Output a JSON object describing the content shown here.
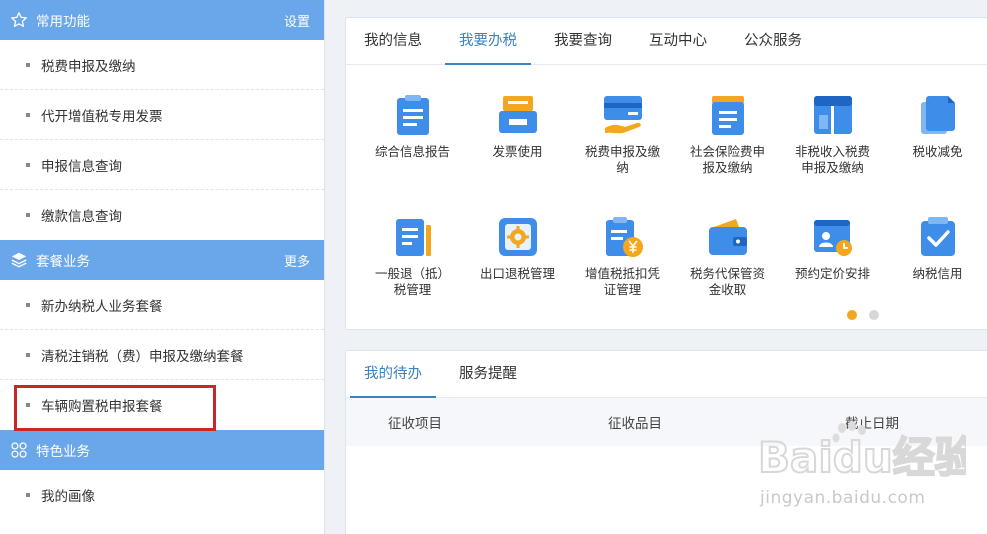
{
  "sidebar": {
    "common": {
      "title": "常用功能",
      "action": "设置",
      "items": [
        "税费申报及缴纳",
        "代开增值税专用发票",
        "申报信息查询",
        "缴款信息查询"
      ]
    },
    "package": {
      "title": "套餐业务",
      "action": "更多",
      "items": [
        "新办纳税人业务套餐",
        "清税注销税（费）申报及缴纳套餐",
        "车辆购置税申报套餐"
      ]
    },
    "special": {
      "title": "特色业务",
      "items": [
        "我的画像"
      ]
    }
  },
  "main": {
    "tabs": [
      "我的信息",
      "我要办税",
      "我要查询",
      "互动中心",
      "公众服务"
    ],
    "active_tab": "我要办税",
    "tiles": [
      {
        "label": "综合信息报告",
        "icon": "clipboard-report-icon"
      },
      {
        "label": "发票使用",
        "icon": "invoice-printer-icon"
      },
      {
        "label": "税费申报及缴纳",
        "icon": "card-hand-icon"
      },
      {
        "label": "社会保险费申报及缴纳",
        "icon": "social-insurance-icon"
      },
      {
        "label": "非税收入税费申报及缴纳",
        "icon": "non-tax-revenue-icon"
      },
      {
        "label": "税收减免",
        "icon": "tax-relief-icon"
      },
      {
        "label": "一般退（抵）税管理",
        "icon": "tax-refund-icon"
      },
      {
        "label": "出口退税管理",
        "icon": "export-refund-gear-icon"
      },
      {
        "label": "增值税抵扣凭证管理",
        "icon": "vat-deduction-yen-icon"
      },
      {
        "label": "税务代保管资金收取",
        "icon": "wallet-icon"
      },
      {
        "label": "预约定价安排",
        "icon": "pricing-appointment-icon"
      },
      {
        "label": "纳税信用",
        "icon": "tax-credit-check-icon"
      }
    ]
  },
  "todo": {
    "tabs": [
      "我的待办",
      "服务提醒"
    ],
    "columns": [
      "征收项目",
      "征收品目",
      "截止日期"
    ]
  },
  "watermark": {
    "brand": "Baidu经验",
    "url": "jingyan.baidu.com"
  },
  "colors": {
    "sidebar_header": "#6aa7ea",
    "tab_active": "#3b82c4",
    "highlight_box": "#c9262c",
    "pager_active": "#f3a71e"
  }
}
